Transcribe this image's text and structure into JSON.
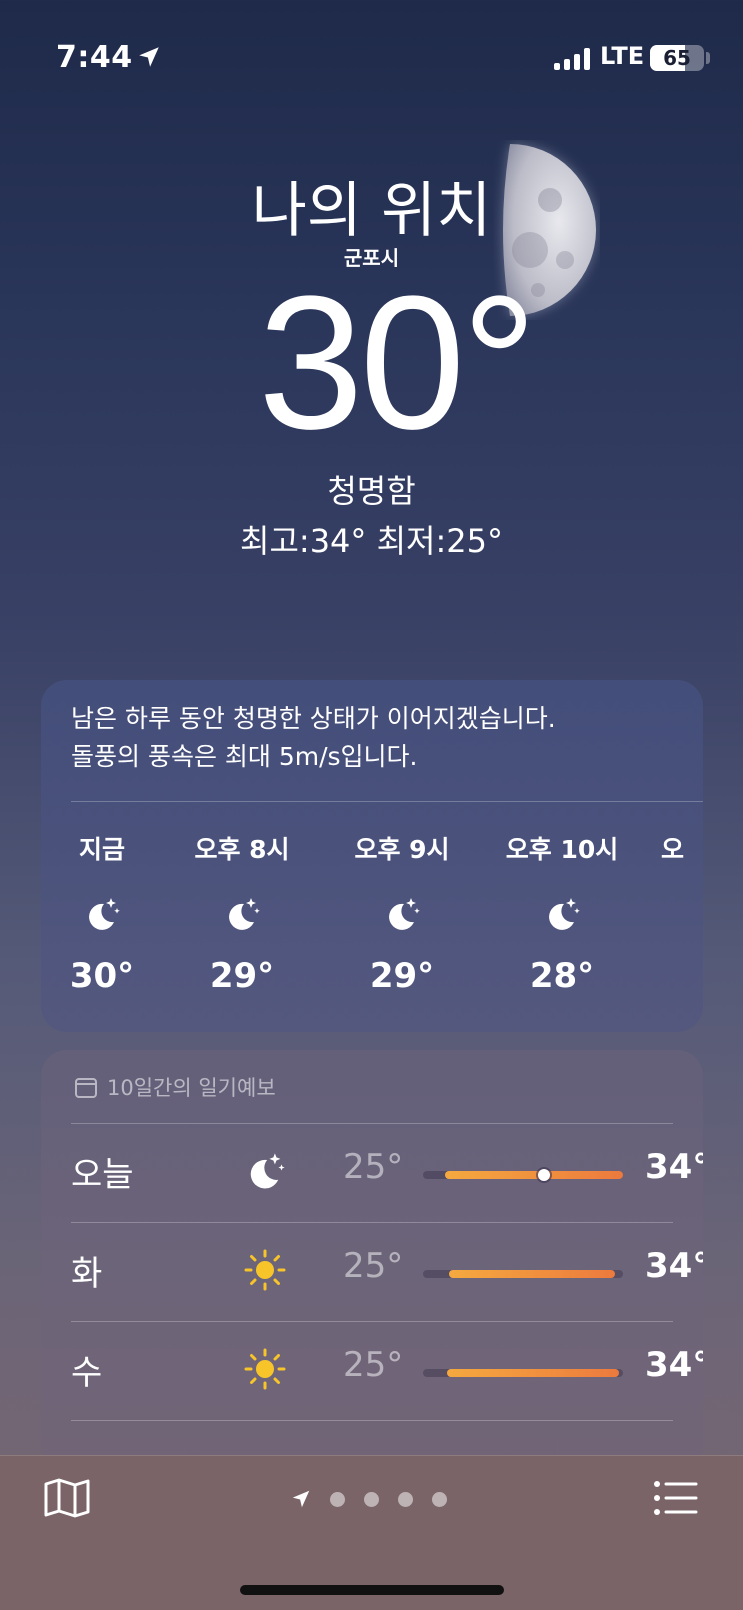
{
  "status_bar": {
    "time": "7:44",
    "network": "LTE",
    "battery": "65",
    "battery_level_percent": 65
  },
  "header": {
    "title": "나의 위치",
    "subtitle": "군포시",
    "temperature": "30°",
    "condition": "청명함",
    "high_low": "최고:34°  최저:25°",
    "background_icon": "moon-half"
  },
  "hourly": {
    "summary_line1": "남은 하루 동안 청명한 상태가 이어지겠습니다.",
    "summary_line2": "돌풍의 풍속은 최대 5m/s입니다.",
    "items": [
      {
        "label": "지금",
        "icon": "moon-stars-icon",
        "temp": "30°"
      },
      {
        "label": "오후 8시",
        "icon": "moon-stars-icon",
        "temp": "29°"
      },
      {
        "label": "오후 9시",
        "icon": "moon-stars-icon",
        "temp": "29°"
      },
      {
        "label": "오후 10시",
        "icon": "moon-stars-icon",
        "temp": "28°"
      },
      {
        "label": "오",
        "icon": "",
        "temp": ""
      }
    ]
  },
  "daily": {
    "header": "10일간의 일기예보",
    "rows": [
      {
        "day": "오늘",
        "icon": "moon-stars-icon",
        "low": "25°",
        "high": "34°",
        "current_marker": true,
        "current_temp": 30
      },
      {
        "day": "화",
        "icon": "sun-icon",
        "low": "25°",
        "high": "34°",
        "current_marker": false
      },
      {
        "day": "수",
        "icon": "sun-icon",
        "low": "25°",
        "high": "34°",
        "current_marker": false
      }
    ]
  },
  "bottom_bar": {
    "map_icon": "map-icon",
    "list_icon": "list-icon",
    "page_count": 4,
    "current_page": "location"
  },
  "colors": {
    "temp_bar_start": "#f5a93f",
    "temp_bar_end": "#ec7a3e",
    "sun": "#f7c52a"
  }
}
